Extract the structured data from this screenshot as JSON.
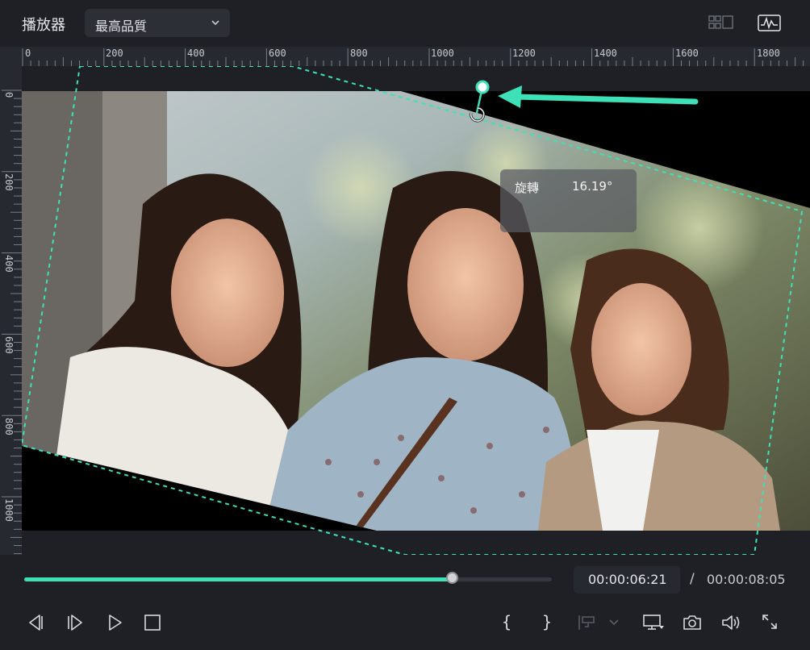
{
  "header": {
    "title": "播放器",
    "quality": {
      "selected": "最高品質"
    }
  },
  "ruler": {
    "horizontal": [
      "0",
      "200",
      "400",
      "600",
      "800",
      "1000",
      "1200",
      "1400",
      "1600",
      "1800"
    ],
    "vertical": [
      "0",
      "200",
      "400",
      "600",
      "800",
      "1000"
    ]
  },
  "preview": {
    "rotation_tooltip": {
      "label": "旋轉",
      "value": "16.19°"
    },
    "rotation_degrees": 16.19
  },
  "playback": {
    "current_time": "00:00:06:21",
    "separator": "/",
    "total_time": "00:00:08:05",
    "progress": 0.81
  },
  "colors": {
    "accent": "#3ee0b8",
    "background": "#1e2026",
    "panel": "#262930"
  },
  "icons": {
    "top": [
      "grid-layout-icon",
      "waveform-monitor-icon"
    ],
    "transport": [
      "prev-frame-icon",
      "next-frame-icon",
      "play-icon",
      "stop-icon"
    ],
    "right": [
      "mark-in-icon",
      "mark-out-icon",
      "insert-clip-icon",
      "display-icon",
      "snapshot-icon",
      "volume-icon",
      "fullscreen-icon"
    ]
  }
}
